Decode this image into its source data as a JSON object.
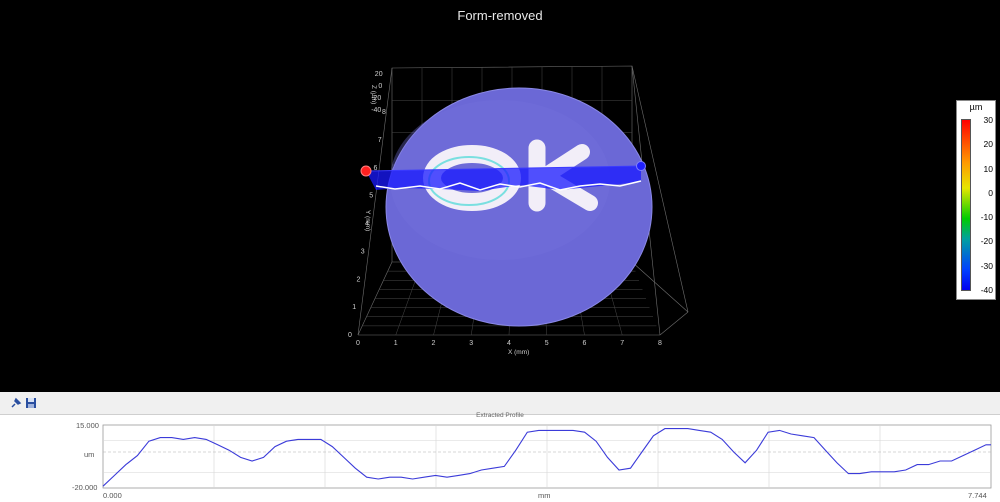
{
  "viewer": {
    "title": "Form-removed",
    "axis_labels": {
      "x": "X (mm)",
      "y": "Y (mm)",
      "z": "Z (µm)"
    },
    "x_ticks": [
      "0",
      "1",
      "2",
      "3",
      "4",
      "5",
      "6",
      "7",
      "8"
    ],
    "y_ticks": [
      "0",
      "1",
      "2",
      "3",
      "4",
      "5",
      "6",
      "7",
      "8"
    ],
    "z_ticks": [
      "20",
      "0",
      "-20",
      "-40"
    ],
    "surface_text": "OK",
    "colors": {
      "surface": "#6b68d6",
      "profile_plane": "#1a1aff",
      "marker_start": "#ff2020",
      "marker_end": "#2020ff",
      "background": "#000000"
    }
  },
  "color_scale": {
    "unit": "µm",
    "ticks": [
      "30",
      "20",
      "10",
      "0",
      "-10",
      "-20",
      "-30",
      "-40"
    ]
  },
  "toolbar": {
    "icons": [
      "pin-icon",
      "save-icon"
    ]
  },
  "chart_data": {
    "type": "line",
    "title": "Extracted Profile",
    "xlabel": "mm",
    "ylabel": "um",
    "xlim": [
      0.0,
      7.744
    ],
    "ylim": [
      -20.0,
      15.0
    ],
    "x_tick_labels": [
      "0.000",
      "7.744"
    ],
    "y_tick_labels": [
      "15.000",
      "-20.000"
    ],
    "grid": true,
    "series": [
      {
        "color": "#3b3bd9",
        "x": [
          0.0,
          0.1,
          0.2,
          0.3,
          0.4,
          0.5,
          0.6,
          0.7,
          0.8,
          0.9,
          1.0,
          1.1,
          1.2,
          1.3,
          1.4,
          1.5,
          1.6,
          1.7,
          1.8,
          1.9,
          2.0,
          2.1,
          2.2,
          2.3,
          2.4,
          2.5,
          2.6,
          2.7,
          2.8,
          2.9,
          3.0,
          3.1,
          3.2,
          3.3,
          3.4,
          3.5,
          3.6,
          3.7,
          3.8,
          3.9,
          4.0,
          4.1,
          4.2,
          4.3,
          4.4,
          4.5,
          4.6,
          4.7,
          4.8,
          4.9,
          5.0,
          5.1,
          5.2,
          5.3,
          5.4,
          5.5,
          5.6,
          5.7,
          5.8,
          5.9,
          6.0,
          6.1,
          6.2,
          6.3,
          6.4,
          6.5,
          6.6,
          6.7,
          6.8,
          6.9,
          7.0,
          7.1,
          7.2,
          7.3,
          7.4,
          7.5,
          7.6,
          7.7,
          7.744
        ],
        "values": [
          -19,
          -13,
          -7,
          -2,
          6,
          8,
          8,
          7,
          8,
          7,
          4,
          1,
          -3,
          -5,
          -3,
          3,
          6,
          7,
          7,
          7,
          3,
          -3,
          -9,
          -14,
          -15,
          -14,
          -14,
          -15,
          -14,
          -13,
          -14,
          -13,
          -12,
          -10,
          -9,
          -8,
          1,
          11,
          12,
          12,
          12,
          12,
          11,
          6,
          -3,
          -10,
          -9,
          0,
          9,
          13,
          13,
          13,
          12,
          11,
          7,
          0,
          -6,
          1,
          11,
          12,
          10,
          9,
          8,
          1,
          -6,
          -12,
          -12,
          -11,
          -11,
          -11,
          -10,
          -7,
          -7,
          -5,
          -5,
          -2,
          1,
          4,
          4
        ]
      }
    ]
  }
}
